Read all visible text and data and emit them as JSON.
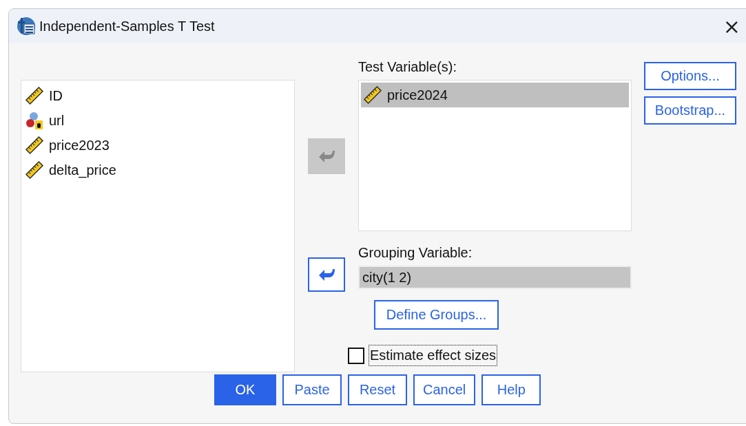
{
  "window": {
    "title": "Independent-Samples T Test",
    "close": "×"
  },
  "source_variables": [
    {
      "name": "ID",
      "kind": "scale"
    },
    {
      "name": "url",
      "kind": "nominal"
    },
    {
      "name": "price2023",
      "kind": "scale"
    },
    {
      "name": "delta_price",
      "kind": "scale"
    }
  ],
  "move_buttons": [
    {
      "disabled": true
    },
    {
      "disabled": false
    }
  ],
  "test_variables": {
    "label": "Test Variable(s):",
    "items": [
      {
        "name": "price2024",
        "kind": "scale",
        "selected": true
      }
    ]
  },
  "grouping_variable": {
    "label": "Grouping Variable:",
    "value": "city(1 2)"
  },
  "define_groups_button": "Define Groups...",
  "side_buttons": [
    "Options...",
    "Bootstrap..."
  ],
  "effect_sizes": {
    "label": "Estimate effect sizes",
    "checked": false,
    "focused": true
  },
  "buttons": [
    {
      "label": "OK",
      "primary": true
    },
    {
      "label": "Paste",
      "primary": false
    },
    {
      "label": "Reset",
      "primary": false
    },
    {
      "label": "Cancel",
      "primary": false
    },
    {
      "label": "Help",
      "primary": false
    }
  ]
}
